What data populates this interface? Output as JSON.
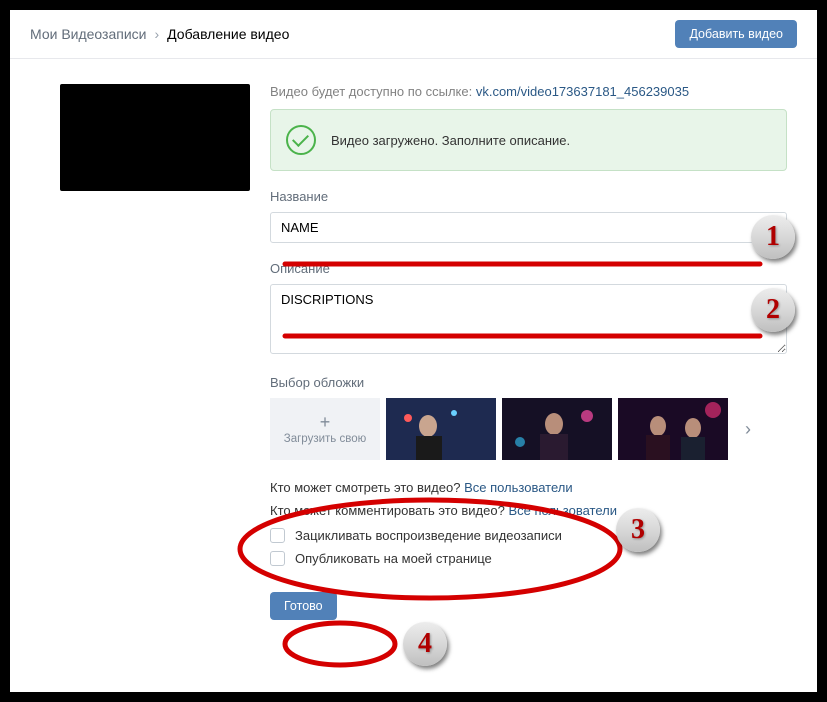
{
  "header": {
    "crumb_back": "Мои Видеозаписи",
    "crumb_current": "Добавление видео",
    "add_button": "Добавить видео"
  },
  "info": {
    "prefix": "Видео будет доступно по ссылке: ",
    "link": "vk.com/video173637181_456239035"
  },
  "success": "Видео загружено. Заполните описание.",
  "title": {
    "label": "Название",
    "value": "NAME"
  },
  "description": {
    "label": "Описание",
    "value": "DISCRIPTIONS"
  },
  "cover": {
    "label": "Выбор обложки",
    "upload": "Загрузить свою"
  },
  "privacy": {
    "view_q": "Кто может смотреть это видео? ",
    "view_a": "Все пользователи",
    "comment_q": "Кто может комментировать это видео? ",
    "comment_a": "Все пользователи"
  },
  "options": {
    "loop": "Зацикливать воспроизведение видеозаписи",
    "publish": "Опубликовать на моей странице"
  },
  "done": "Готово",
  "annotations": {
    "b1": "1",
    "b2": "2",
    "b3": "3",
    "b4": "4"
  }
}
